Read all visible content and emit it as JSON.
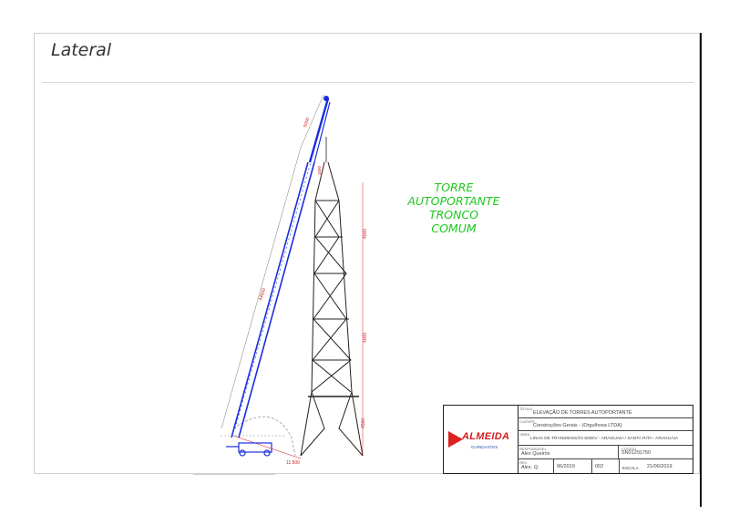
{
  "page": {
    "section_title": "Lateral"
  },
  "drawing": {
    "crane_boom_labels": [
      "5000",
      "44500"
    ],
    "tower_height_labels": [
      "4000",
      "4000",
      "4500",
      "4500"
    ],
    "tower_top_label": "1000",
    "base_label": "11:500",
    "note": [
      "TORRE",
      "AUTOPORTANTE",
      "TRONCO",
      "COMUM"
    ],
    "colors": {
      "crane": "#1a2ee0",
      "tower": "#222222",
      "note": "#1ec81e",
      "dimension": "#d42020"
    }
  },
  "title_block": {
    "logo_text": "ALMEIDA",
    "logo_subtitle": "GUINDASTES",
    "title_label": "TÍTULO",
    "title": "ELEVAÇÃO DE TORRES AUTOPORTANTE",
    "client_label": "CLIENTE",
    "client": "Construções Gerais - (Orgulhosa LTDA)",
    "work_label": "OBRA",
    "work": "LINHA DE TRANSMISSÃO 500KV - ARAGUAIA / SANTA RITA - ARAGUAIA",
    "responsible_label": "RESPONSÁVEL",
    "responsible": "Alex Queirós",
    "code_label": "CÓDIGO",
    "code": "SN01291750",
    "rev_label": "REV.",
    "rev": "Alex. Q.",
    "date": "06/2019",
    "sheet": "002",
    "scale_label": "ESCALA",
    "scale_date": "21/06/2019"
  }
}
